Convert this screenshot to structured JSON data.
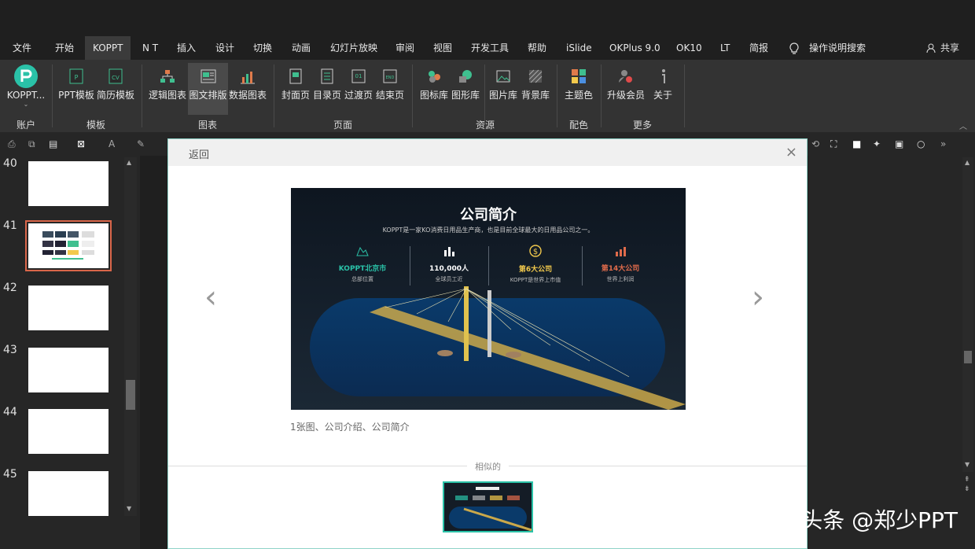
{
  "menu": {
    "tabs": [
      "文件",
      "开始",
      "KOPPT",
      "N T",
      "插入",
      "设计",
      "切换",
      "动画",
      "幻灯片放映",
      "审阅",
      "视图",
      "开发工具",
      "帮助",
      "iSlide",
      "OKPlus 9.0",
      "OK10",
      "LT",
      "简报"
    ],
    "search_label": "操作说明搜索",
    "share_label": "共享"
  },
  "ribbon": {
    "buttons": {
      "koppt": "KOPPT...",
      "ppt_template": "PPT模板",
      "resume_template": "简历模板",
      "logic_chart": "逻辑图表",
      "image_layout": "图文排版",
      "data_chart": "数据图表",
      "cover": "封面页",
      "toc": "目录页",
      "transition": "过渡页",
      "ending": "结束页",
      "icon_lib": "图标库",
      "shape_lib": "图形库",
      "image_lib": "图片库",
      "bg_lib": "背景库",
      "theme_color": "主题色",
      "upgrade": "升级会员",
      "about": "关于"
    },
    "groups": {
      "account": "账户",
      "template": "模板",
      "chart": "图表",
      "page": "页面",
      "resource": "资源",
      "color": "配色",
      "more": "更多"
    },
    "colors": {
      "koppt_logo": "#2ac2a8"
    }
  },
  "slides": {
    "numbers": [
      "40",
      "41",
      "42",
      "43",
      "44",
      "45"
    ],
    "selected": "41",
    "selected_color": "#d9664a"
  },
  "dialog": {
    "back_label": "返回",
    "close_glyph": "×",
    "prev_glyph": "‹",
    "next_glyph": "›",
    "caption": "1张图、公司介绍、公司简介",
    "similar_label": "相似的",
    "preview": {
      "title": "公司简介",
      "subtitle": "KOPPT是一家KO消费日用品生产商，也是目前全球最大的日用品公司之一。",
      "stats": [
        {
          "value": "KOPPT北京市",
          "label": "总部位置",
          "color": "#2ac2a8"
        },
        {
          "value": "110,000人",
          "label": "全球员工近",
          "color": "#ffffff"
        },
        {
          "value": "第6大公司",
          "label": "KOPPT是世界上市值",
          "color": "#f2c94c"
        },
        {
          "value": "第14大公司",
          "label": "世界上利润",
          "color": "#e06b4b"
        }
      ]
    }
  },
  "watermark": "头条 @郑少PPT"
}
